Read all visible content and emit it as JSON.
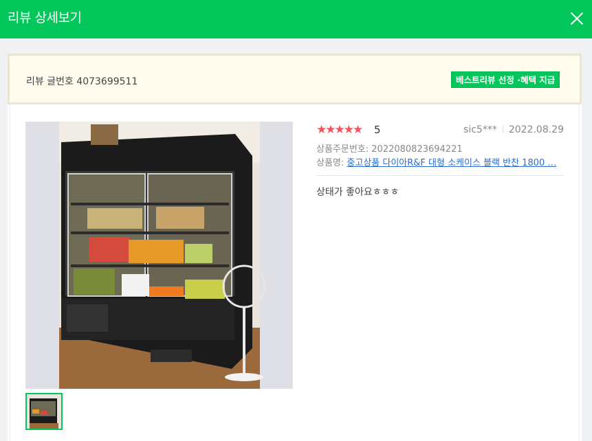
{
  "header": {
    "title": "리뷰 상세보기",
    "close_icon": "close-icon"
  },
  "info_bar": {
    "review_number": "리뷰 글번호 4073699511",
    "best_review_button": "베스트리뷰 선정 ·혜택 지급"
  },
  "review": {
    "stars": "★★★★★",
    "rating": "5",
    "author": "sic5***",
    "date": "2022.08.29",
    "order_number": "상품주문번호: 2022080823694221",
    "product_label": "상품명: ",
    "product_name": "중고상품 다이아R&F 대형 소케이스 블랙 반찬 1800 …",
    "content": "상태가 좋아요ㅎㅎㅎ"
  },
  "colors": {
    "brand": "#03c75a",
    "star": "#f5525a",
    "link": "#2a6bd1"
  }
}
